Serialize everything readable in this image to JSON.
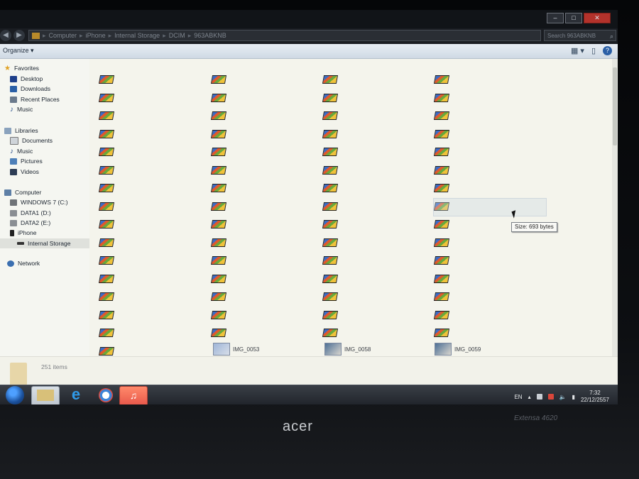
{
  "window": {
    "controls": {
      "minimize": "–",
      "maximize": "□",
      "close": "✕"
    }
  },
  "address": {
    "breadcrumb": [
      "Computer",
      "iPhone",
      "Internal Storage",
      "DCIM",
      "963ABKNB"
    ],
    "search_placeholder": "Search 963ABKNB"
  },
  "toolbar": {
    "organize_label": "Organize"
  },
  "navigation": {
    "favorites_header": "Favorites",
    "favorites": [
      "Desktop",
      "Downloads",
      "Recent Places",
      "Music"
    ],
    "libraries_header": "Libraries",
    "libraries": [
      "Documents",
      "Music",
      "Pictures",
      "Videos"
    ],
    "computer_header": "Computer",
    "drives": [
      "WINDOWS 7 (C:)",
      "DATA1 (D:)",
      "DATA2 (E:)",
      "iPhone",
      "Internal Storage"
    ],
    "network": "Network"
  },
  "files": {
    "thumbnails": [
      {
        "name": "IMG_0053"
      },
      {
        "name": "IMG_0058"
      },
      {
        "name": "IMG_0059"
      }
    ],
    "tooltip": "Size: 693 bytes"
  },
  "details": {
    "item_count": "251 items"
  },
  "taskbar": {
    "language": "EN",
    "time": "7:32",
    "date": "22/12/2557"
  },
  "device": {
    "brand": "acer",
    "model": "Extensa 4620"
  },
  "colors": {
    "accent": "#2a5fa6",
    "taskbar": "#2b2f36",
    "itunes": "#e8574a"
  }
}
